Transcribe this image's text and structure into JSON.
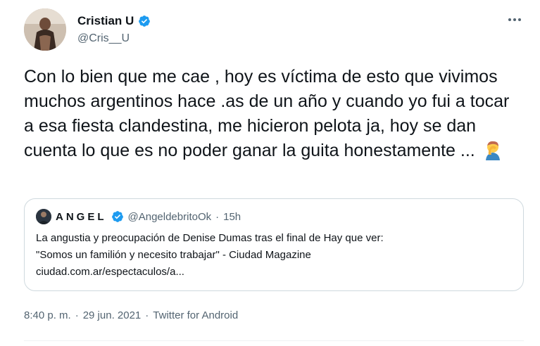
{
  "author": {
    "display_name": "Cristian U",
    "handle": "@Cris__U",
    "verified": true
  },
  "tweet": {
    "text": "Con lo bien que me cae , hoy es víctima de esto que vivimos muchos argentinos hace .as de un año y cuando yo fui a tocar a esa fiesta clandestina, me hicieron pelota ja, hoy se dan cuenta lo que es no poder ganar la guita honestamente ...",
    "emoji": "person-facepalming"
  },
  "quote": {
    "display_name": "ANGEL",
    "handle": "@AngeldebritoOk",
    "separator": "·",
    "time": "15h",
    "lines": [
      "La angustia y preocupación de Denise Dumas tras el final de Hay que ver:",
      "\"Somos un familión y necesito trabajar\" - Ciudad Magazine",
      "ciudad.com.ar/espectaculos/a..."
    ]
  },
  "meta": {
    "time": "8:40 p. m.",
    "sep1": "·",
    "date": "29 jun. 2021",
    "sep2": "·",
    "source": "Twitter for Android"
  },
  "icons": {
    "verified": "verified-badge-icon",
    "more": "more-options-icon",
    "emoji": "facepalm-emoji-icon"
  },
  "colors": {
    "verified_blue": "#1d9bf0",
    "secondary_text": "#536471",
    "border": "#cfd9de"
  }
}
